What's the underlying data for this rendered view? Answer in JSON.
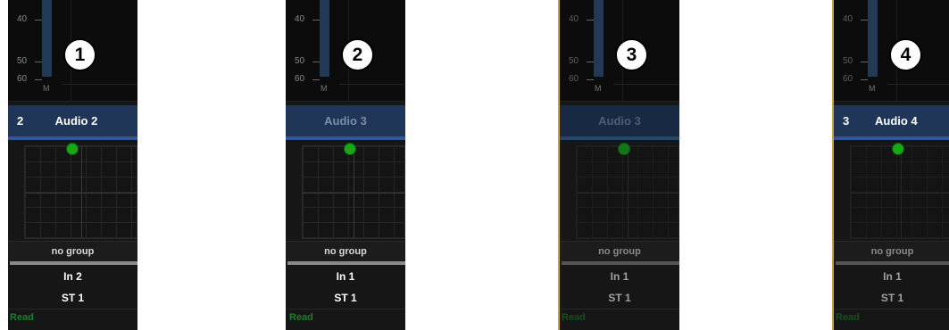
{
  "strips": [
    {
      "badge": "1",
      "meter": {
        "ticks": [
          "40",
          "50",
          "60"
        ],
        "label": "M"
      },
      "track_number": "2",
      "track_name": "Audio 2",
      "group": "no group",
      "input": "In 2",
      "output": "ST 1",
      "automation": "Read"
    },
    {
      "badge": "2",
      "meter": {
        "ticks": [
          "40",
          "50",
          "60"
        ],
        "label": "M"
      },
      "track_number": "",
      "track_name": "Audio 3",
      "group": "no group",
      "input": "In 1",
      "output": "ST 1",
      "automation": "Read"
    },
    {
      "badge": "3",
      "meter": {
        "ticks": [
          "40",
          "50",
          "60"
        ],
        "label": "M"
      },
      "track_number": "",
      "track_name": "Audio 3",
      "group": "no group",
      "input": "In 1",
      "output": "ST 1",
      "automation": "Read"
    },
    {
      "badge": "4",
      "meter": {
        "ticks": [
          "40",
          "50",
          "60"
        ],
        "label": "M"
      },
      "track_number": "3",
      "track_name": "Audio 4",
      "group": "no group",
      "input": "In 1",
      "output": "ST 1",
      "automation": "Read"
    }
  ],
  "colors": {
    "name_bar": "#1f3658",
    "pan_dot": "#19a719",
    "automation_read": "#1f7d2a"
  }
}
